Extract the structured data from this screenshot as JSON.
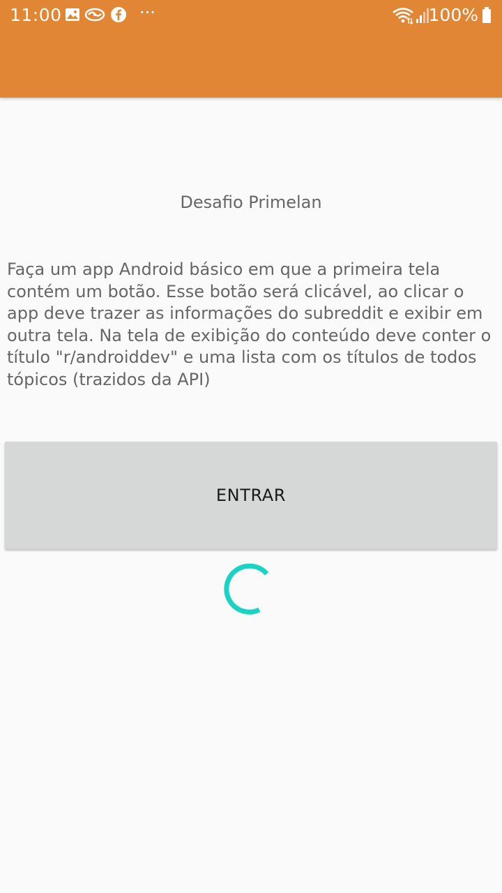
{
  "status_bar": {
    "time": "11:00",
    "battery_percent": "100%",
    "overflow": "···",
    "icons": [
      "image-icon",
      "handshake-icon",
      "facebook-icon",
      "more-dots-icon",
      "wifi-icon",
      "signal-icon",
      "battery-icon"
    ]
  },
  "colors": {
    "app_bar": "#e08635",
    "background": "#fafafa",
    "button": "#d6d7d7",
    "spinner": "#1ad3c3",
    "text": "#666666"
  },
  "content": {
    "title": "Desafio Primelan",
    "description": "Faça um app Android básico em que a primeira tela contém um botão. Esse botão será clicável, ao clicar o app deve trazer as informações do subreddit e exibir em outra tela. Na tela de exibição do conteúdo deve conter o título \"r/androiddev\" e uma lista com os títulos de todos tópicos (trazidos da API)"
  },
  "button": {
    "label": "ENTRAR"
  },
  "loading": {
    "icon": "loading-spinner-icon"
  }
}
